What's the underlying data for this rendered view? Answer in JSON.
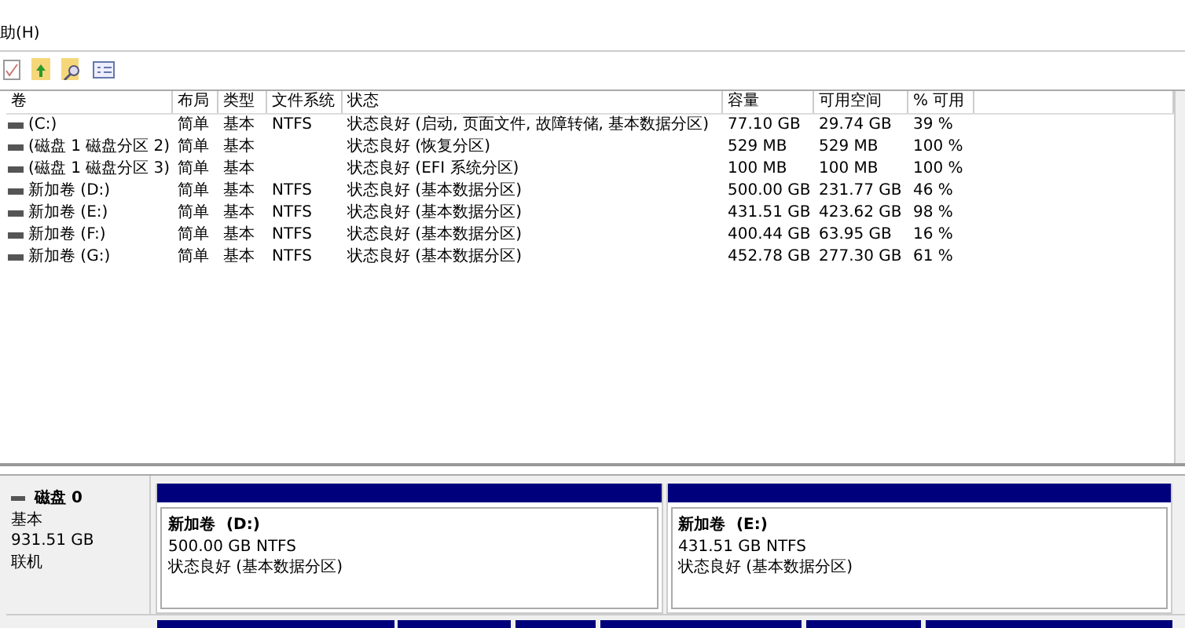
{
  "menu": [
    {
      "label": "助(H)"
    }
  ],
  "table": {
    "columns": [
      "卷",
      "布局",
      "类型",
      "文件系统",
      "状态",
      "容量",
      "可用空间",
      "% 可用"
    ],
    "rows": [
      [
        "(C:)",
        "简单",
        "基本",
        "NTFS",
        "状态良好 (启动, 页面文件, 故障转储, 基本数据分区)",
        "77.10 GB",
        "29.74 GB",
        "39 %"
      ],
      [
        "(磁盘 1 磁盘分区 2)",
        "简单",
        "基本",
        "",
        "状态良好 (恢复分区)",
        "529 MB",
        "529 MB",
        "100 %"
      ],
      [
        "(磁盘 1 磁盘分区 3)",
        "简单",
        "基本",
        "",
        "状态良好 (EFI 系统分区)",
        "100 MB",
        "100 MB",
        "100 %"
      ],
      [
        "新加卷 (D:)",
        "简单",
        "基本",
        "NTFS",
        "状态良好 (基本数据分区)",
        "500.00 GB",
        "231.77 GB",
        "46 %"
      ],
      [
        "新加卷 (E:)",
        "简单",
        "基本",
        "NTFS",
        "状态良好 (基本数据分区)",
        "431.51 GB",
        "423.62 GB",
        "98 %"
      ],
      [
        "新加卷 (F:)",
        "简单",
        "基本",
        "NTFS",
        "状态良好 (基本数据分区)",
        "400.44 GB",
        "63.95 GB",
        "16 %"
      ],
      [
        "新加卷 (G:)",
        "简单",
        "基本",
        "NTFS",
        "状态良好 (基本数据分区)",
        "452.78 GB",
        "277.30 GB",
        "61 %"
      ]
    ]
  },
  "disk": {
    "name": "磁盘 0",
    "type": "基本",
    "size": "931.51 GB",
    "status": "联机",
    "partitions": [
      {
        "name": "新加卷  (D:)",
        "size": "500.00 GB NTFS",
        "status": "状态良好 (基本数据分区)"
      },
      {
        "name": "新加卷  (E:)",
        "size": "431.51 GB NTFS",
        "status": "状态良好 (基本数据分区)"
      }
    ]
  }
}
